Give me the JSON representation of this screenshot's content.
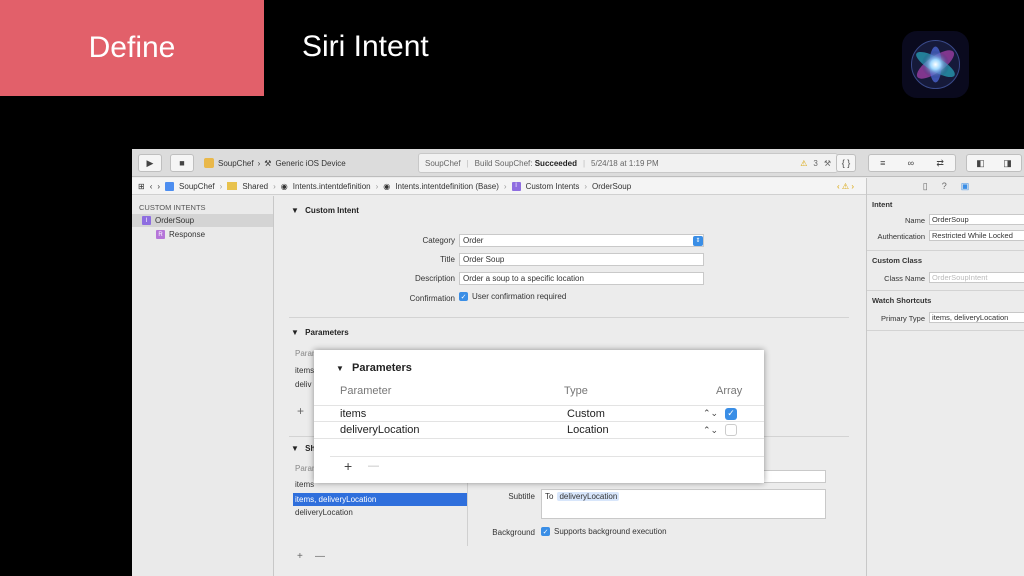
{
  "slide": {
    "section_label": "Define",
    "title": "Siri Intent"
  },
  "toolbar": {
    "scheme": "SoupChef",
    "destination": "Generic iOS Device",
    "status_app": "SoupChef",
    "status_text": "Build SoupChef: ",
    "status_result": "Succeeded",
    "status_time": "5/24/18 at 1:19 PM",
    "warning_count": "3"
  },
  "jumpbar": {
    "items": [
      "SoupChef",
      "Shared",
      "Intents.intentdefinition",
      "Intents.intentdefinition (Base)",
      "Custom Intents",
      "OrderSoup"
    ]
  },
  "navigator": {
    "header": "CUSTOM INTENTS",
    "intent": "OrderSoup",
    "response": "Response"
  },
  "editor": {
    "custom_intent_title": "Custom Intent",
    "category_label": "Category",
    "category_value": "Order",
    "title_label": "Title",
    "title_value": "Order Soup",
    "description_label": "Description",
    "description_value": "Order a soup to a specific location",
    "confirmation_label": "Confirmation",
    "confirmation_value": "User confirmation required",
    "parameters_title": "Parameters",
    "param_header": "Param",
    "param_items": [
      "items",
      "deliv"
    ],
    "shortcuts_title_partial": "Sh",
    "shortcuts_header": "Param",
    "shortcut_items": [
      "items",
      "items, deliveryLocation",
      "deliveryLocation"
    ],
    "subtitle_label": "Subtitle",
    "subtitle_prefix": "To",
    "subtitle_token": "deliveryLocation",
    "background_label": "Background",
    "background_value": "Supports background execution"
  },
  "inspector": {
    "intent_section": "Intent",
    "name_label": "Name",
    "name_value": "OrderSoup",
    "auth_label": "Authentication",
    "auth_value": "Restricted While Locked",
    "custom_class_section": "Custom Class",
    "class_name_label": "Class Name",
    "class_name_placeholder": "OrderSoupIntent",
    "watch_section": "Watch Shortcuts",
    "primary_type_label": "Primary Type",
    "primary_type_value": "items, deliveryLocation"
  },
  "popup": {
    "title": "Parameters",
    "col_parameter": "Parameter",
    "col_type": "Type",
    "col_array": "Array",
    "rows": [
      {
        "name": "items",
        "type": "Custom",
        "array": true
      },
      {
        "name": "deliveryLocation",
        "type": "Location",
        "array": false
      }
    ],
    "add": "+",
    "remove": "—"
  },
  "colors": {
    "accent_define": "#e2606a",
    "checkbox_blue": "#3a8ee6",
    "selection_blue": "#2f6fdc"
  }
}
